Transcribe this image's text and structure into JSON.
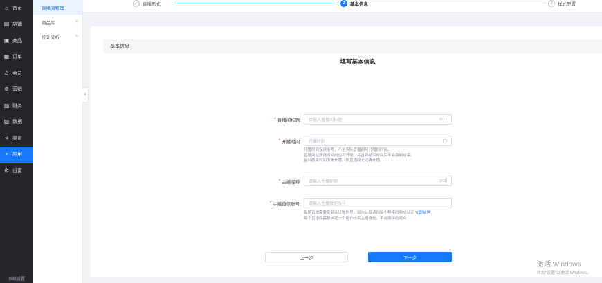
{
  "nav": {
    "items": [
      {
        "label": "首页",
        "icon": "home-icon",
        "glyph": "⌂"
      },
      {
        "label": "店铺",
        "icon": "store-icon",
        "glyph": "▤"
      },
      {
        "label": "商品",
        "icon": "goods-icon",
        "glyph": "▣"
      },
      {
        "label": "订单",
        "icon": "order-icon",
        "glyph": "▦"
      },
      {
        "label": "会员",
        "icon": "member-icon",
        "glyph": "♙"
      },
      {
        "label": "营销",
        "icon": "marketing-icon",
        "glyph": "⊛"
      },
      {
        "label": "财务",
        "icon": "finance-icon",
        "glyph": "▥"
      },
      {
        "label": "数据",
        "icon": "data-icon",
        "glyph": "▧"
      },
      {
        "label": "渠道",
        "icon": "channel-icon",
        "glyph": "⋖"
      },
      {
        "label": "应用",
        "icon": "apps-icon",
        "glyph": "▪"
      },
      {
        "label": "设置",
        "icon": "settings-icon",
        "glyph": "⚙"
      }
    ],
    "active_index": 9,
    "bottom_label": "系统设置"
  },
  "subnav": {
    "items": [
      {
        "label": "直播间管理",
        "has_chevron": false
      },
      {
        "label": "商品库",
        "has_chevron": true
      },
      {
        "label": "统计分析",
        "has_chevron": true
      }
    ],
    "chevron": ">",
    "collapse_glyph": "≡"
  },
  "steps": [
    {
      "number": "✓",
      "label": "直播形式",
      "state": "done"
    },
    {
      "number": "2",
      "label": "基本信息",
      "state": "current"
    },
    {
      "number": "3",
      "label": "样式配置",
      "state": "todo"
    }
  ],
  "section": {
    "title": "基本信息"
  },
  "form": {
    "title": "填写基本信息",
    "fields": {
      "room_title": {
        "label": "直播间标题:",
        "placeholder": "请输入直播间标题",
        "count": "0/17"
      },
      "start_time": {
        "label": "开播时间:",
        "placeholder": "开播时间",
        "hint": [
          "开播时间仅供参考，不是实际直播间可开播的时间。",
          "直播间在开播时间前也可开播，并且到结束时间后不会强制结束。",
          "若到结束时间仍未开播，则直播间无法再开播。"
        ]
      },
      "anchor_name": {
        "label": "主播昵称:",
        "placeholder": "请输入主播昵称",
        "count": "0/15"
      },
      "anchor_wechat": {
        "label": "主播微信账号:",
        "placeholder": "请输入主播微信账号",
        "hint_line1": "每场直播需要实名认证微信号，如未认证请扫描小程序码完成认证",
        "hint_link": "立即前往",
        "hint_line2": "每个直播间需要绑定一个用作核实主播身份，不会展示给观众"
      }
    },
    "prev_label": "上一步",
    "next_label": "下一步"
  },
  "watermark": {
    "line1": "激活 Windows",
    "line2": "转到“设置”以激活 Windows。"
  }
}
